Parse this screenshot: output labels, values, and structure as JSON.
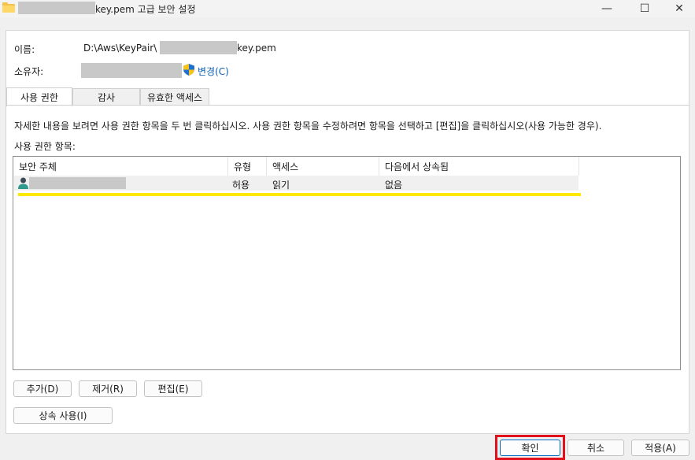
{
  "window": {
    "title_suffix": "key.pem 고급 보안 설정",
    "minimize": "—",
    "maximize": "☐",
    "close": "✕"
  },
  "info": {
    "name_label": "이름:",
    "path_prefix": "D:\\Aws\\KeyPair\\",
    "path_suffix": "key.pem",
    "owner_label": "소유자:",
    "change_link": "변경(C)"
  },
  "tabs": [
    {
      "label": "사용 권한",
      "active": true
    },
    {
      "label": "감사",
      "active": false
    },
    {
      "label": "유효한 액세스",
      "active": false
    }
  ],
  "instructions": "자세한 내용을 보려면 사용 권한 항목을 두 번 클릭하십시오. 사용 권한 항목을 수정하려면 항목을 선택하고 [편집]을 클릭하십시오(사용 가능한 경우).",
  "entries_label": "사용 권한 항목:",
  "table": {
    "columns": [
      "보안 주체",
      "유형",
      "액세스",
      "다음에서 상속됨"
    ],
    "rows": [
      {
        "principal": "",
        "type": "허용",
        "access": "읽기",
        "inherited_from": "없음"
      }
    ]
  },
  "buttons": {
    "add": "추가(D)",
    "remove": "제거(R)",
    "edit": "편집(E)",
    "enable_inheritance": "상속 사용(I)",
    "ok": "확인",
    "cancel": "취소",
    "apply": "적용(A)"
  },
  "colors": {
    "highlight": "#ffe800",
    "focus_box": "#e0101c",
    "link": "#0a5fb4"
  },
  "icons": [
    "folder-icon",
    "shield-icon",
    "user-icon"
  ]
}
